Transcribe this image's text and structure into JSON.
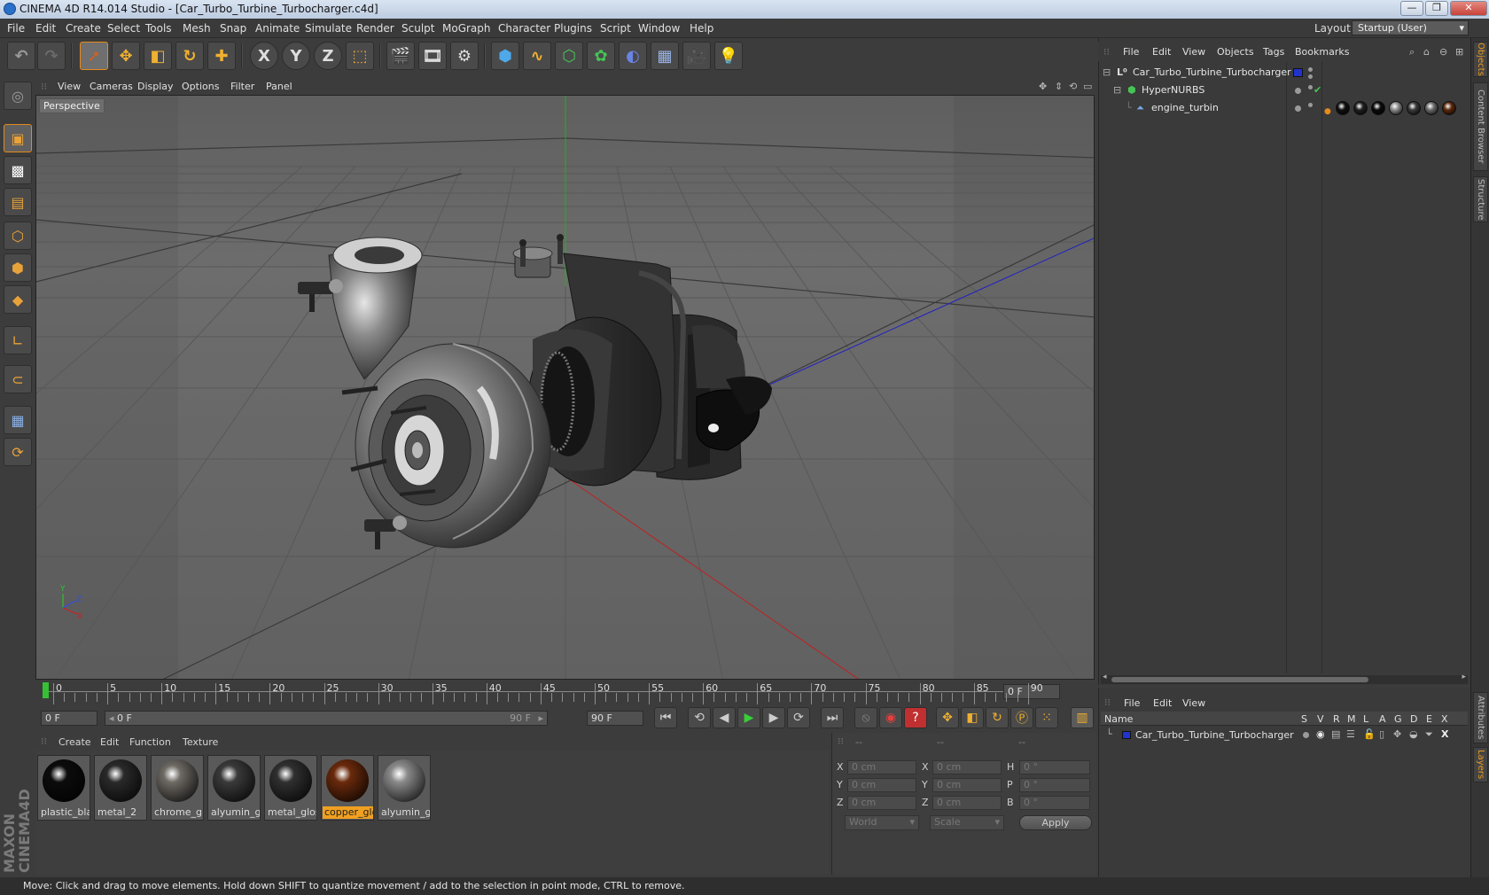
{
  "window": {
    "title": "CINEMA 4D R14.014 Studio - [Car_Turbo_Turbine_Turbocharger.c4d]",
    "btn_minimize": "—",
    "btn_restore": "❐",
    "btn_close": "✕",
    "close_color": "#c8433a"
  },
  "menubar": {
    "items": [
      "File",
      "Edit",
      "Create",
      "Select",
      "Tools",
      "Mesh",
      "Snap",
      "Animate",
      "Simulate",
      "Render",
      "Sculpt",
      "MoGraph",
      "Character",
      "Plugins",
      "Script",
      "Window",
      "Help"
    ],
    "layout_label": "Layout:",
    "layout_value": "Startup (User)"
  },
  "toolbar": {
    "icons": [
      "undo-icon",
      "redo-icon",
      "live-selection-icon",
      "move-icon",
      "scale-icon",
      "rotate-icon",
      "recent-tool-icon",
      "x-axis-icon",
      "y-axis-icon",
      "z-axis-icon",
      "coordinate-system-icon",
      "render-view-icon",
      "render-picture-viewer-icon",
      "edit-render-settings-icon",
      "cube-primitive-icon",
      "spline-icon",
      "subdivision-nurbs-icon",
      "mograph-cloner-icon",
      "deformer-icon",
      "floor-scene-icon",
      "camera-icon",
      "light-icon"
    ],
    "axis_labels": [
      "X",
      "Y",
      "Z"
    ]
  },
  "viewport": {
    "menu": [
      "View",
      "Cameras",
      "Display",
      "Options",
      "Filter",
      "Panel"
    ],
    "label": "Perspective",
    "axis_labels": [
      "Y",
      "Z",
      "X"
    ]
  },
  "timeline": {
    "ticks": [
      "0",
      "5",
      "10",
      "15",
      "20",
      "25",
      "30",
      "35",
      "40",
      "45",
      "50",
      "55",
      "60",
      "65",
      "70",
      "75",
      "80",
      "85",
      "90"
    ],
    "current_frame": "0 F",
    "start_frame": "0 F",
    "range_start": "0 F",
    "range_end": "90 F",
    "end_frame": "90 F"
  },
  "materials": {
    "menu": [
      "Create",
      "Edit",
      "Function",
      "Texture"
    ],
    "items": [
      {
        "label": "plastic_bla",
        "color": "#0c0c0c"
      },
      {
        "label": "metal_2",
        "color": "#2a2a2a"
      },
      {
        "label": "chrome_glo",
        "color": "#6e6a64"
      },
      {
        "label": "alyumin_gl",
        "color": "#3a3a3a"
      },
      {
        "label": "metal_glos",
        "color": "#303030"
      },
      {
        "label": "copper_glo",
        "color": "#6a2a0c"
      },
      {
        "label": "alyumin_gl",
        "color": "#8a8a8a"
      }
    ],
    "selected_index": 5
  },
  "coordinates": {
    "headers": [
      "--",
      "--",
      "--"
    ],
    "rows": [
      {
        "axis": "X",
        "pos": "0 cm",
        "size_axis": "X",
        "size": "0 cm",
        "rot_axis": "H",
        "rot": "0 °"
      },
      {
        "axis": "Y",
        "pos": "0 cm",
        "size_axis": "Y",
        "size": "0 cm",
        "rot_axis": "P",
        "rot": "0 °"
      },
      {
        "axis": "Z",
        "pos": "0 cm",
        "size_axis": "Z",
        "size": "0 cm",
        "rot_axis": "B",
        "rot": "0 °"
      }
    ],
    "mode_world": "World",
    "mode_scale": "Scale",
    "apply": "Apply"
  },
  "objects": {
    "menu": [
      "File",
      "Edit",
      "View",
      "Objects",
      "Tags",
      "Bookmarks"
    ],
    "tree": [
      {
        "name": "Car_Turbo_Turbine_Turbocharger",
        "icon": "null-object-icon"
      },
      {
        "name": "HyperNURBS",
        "icon": "hypernurbs-icon"
      },
      {
        "name": "engine_turbin",
        "icon": "polygon-object-icon"
      }
    ],
    "material_tag_colors": [
      "#101010",
      "#202020",
      "#0a0a0a",
      "#8a8a8a",
      "#3a3a3a",
      "#6a6a6a",
      "#5a2a0c"
    ]
  },
  "layers": {
    "menu": [
      "File",
      "Edit",
      "View"
    ],
    "columns": [
      "Name",
      "S",
      "V",
      "R",
      "M",
      "L",
      "A",
      "G",
      "D",
      "E",
      "X"
    ],
    "row": "Car_Turbo_Turbine_Turbocharger"
  },
  "right_tabs": [
    "Objects",
    "Content Browser",
    "Structure",
    "Attributes",
    "Layers"
  ],
  "status": "Move: Click and drag to move elements. Hold down SHIFT to quantize movement / add to the selection in point mode, CTRL to remove.",
  "colors": {
    "accent": "#e68a1a",
    "panel": "#3a3a3a",
    "blue_swatch": "#2233cc"
  }
}
